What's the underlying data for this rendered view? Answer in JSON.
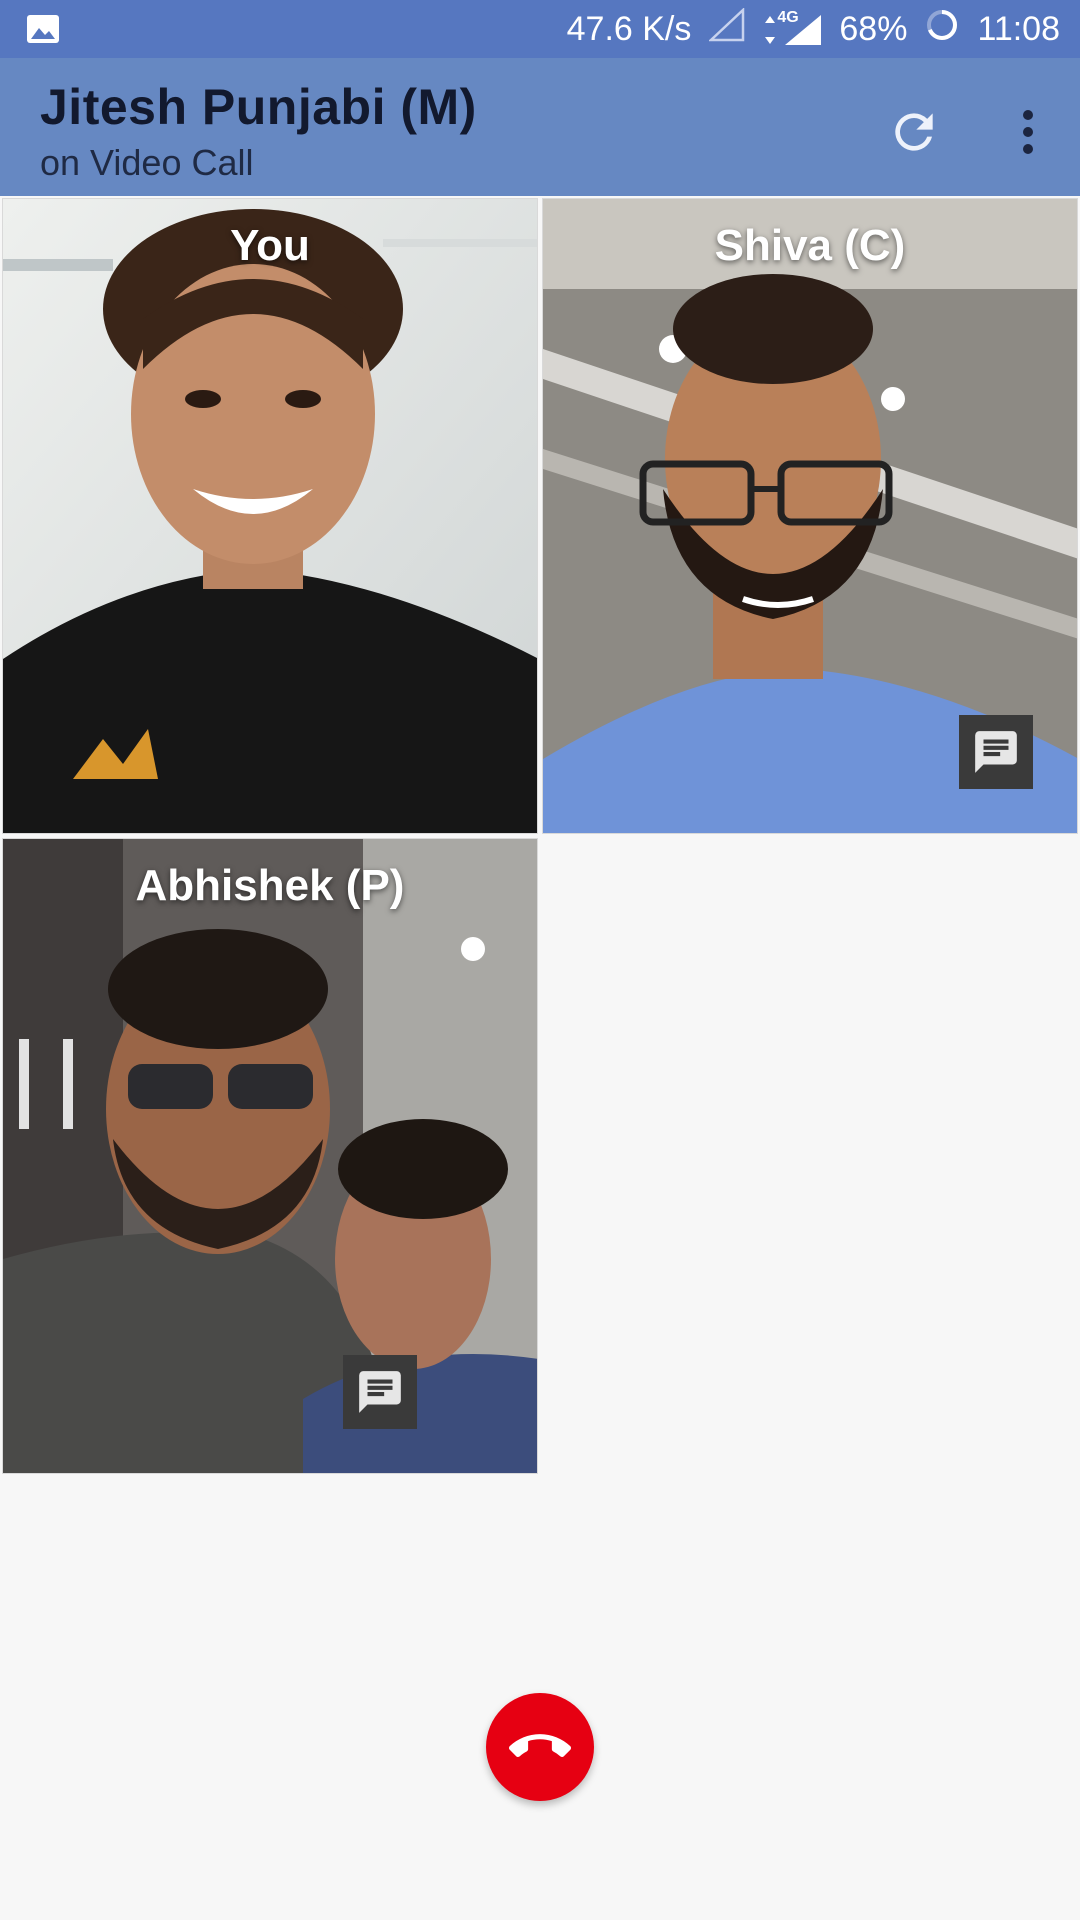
{
  "status_bar": {
    "speed": "47.6 K/s",
    "network": "4G",
    "battery": "68%",
    "time": "11:08",
    "icons": [
      "image-notification-icon",
      "signal-empty-icon",
      "data-arrows-icon",
      "signal-full-icon",
      "battery-ring-icon"
    ]
  },
  "header": {
    "title": "Jitesh Punjabi (M)",
    "subtitle": "on Video Call",
    "icons": [
      "refresh-icon",
      "more-vert-icon"
    ],
    "color": "#6688c2"
  },
  "participants": [
    {
      "label": "You"
    },
    {
      "label": "Shiva (C)"
    },
    {
      "label": "Abhishek (P)"
    }
  ],
  "end_call": {
    "color": "#e60012",
    "icon": "hang-up-phone-icon"
  }
}
